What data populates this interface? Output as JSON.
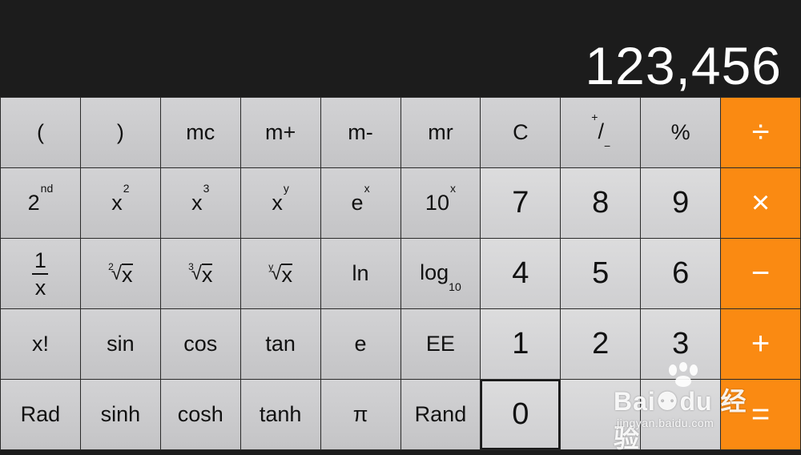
{
  "display": {
    "value": "123,456"
  },
  "keys": {
    "open_paren": "(",
    "close_paren": ")",
    "mc": "mc",
    "m_plus": "m+",
    "m_minus": "m-",
    "mr": "mr",
    "clear": "C",
    "plus_minus_a": "+",
    "plus_minus_b": "/",
    "plus_minus_c": "−",
    "percent": "%",
    "divide": "÷",
    "second_base": "2",
    "second_sup": "nd",
    "x_base": "x",
    "sq_exp": "2",
    "cube_exp": "3",
    "y_exp": "y",
    "e_base": "e",
    "ten_base": "10",
    "one": "1",
    "sqrt_idx": "2",
    "cbrt_idx": "3",
    "yroot_idx": "y",
    "radical": "√",
    "ln": "ln",
    "log_base": "log",
    "log_sub": "10",
    "d7": "7",
    "d8": "8",
    "d9": "9",
    "multiply": "×",
    "d4": "4",
    "d5": "5",
    "d6": "6",
    "minus": "−",
    "factorial": "x!",
    "sin": "sin",
    "cos": "cos",
    "tan": "tan",
    "e": "e",
    "ee": "EE",
    "d1": "1",
    "d2": "2",
    "d3": "3",
    "plus": "+",
    "rad": "Rad",
    "sinh": "sinh",
    "cosh": "cosh",
    "tanh": "tanh",
    "pi": "π",
    "rand": "Rand",
    "d0": "0",
    "decimal": "",
    "equals": "="
  },
  "watermark": {
    "brand": "Bai⚉du 经验",
    "url": "jingyan.baidu.com"
  },
  "colors": {
    "display_bg": "#1c1c1c",
    "function_key": "#c9c9cb",
    "digit_key": "#d5d5d7",
    "operator_key": "#fa8a12"
  }
}
